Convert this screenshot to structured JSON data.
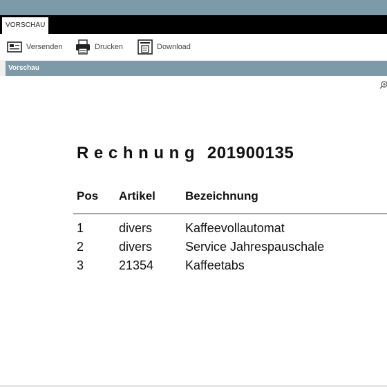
{
  "tab": {
    "label": "VORSCHAU"
  },
  "toolbar": {
    "send_label": "Versenden",
    "print_label": "Drucken",
    "download_label": "Download"
  },
  "section": {
    "title": "Vorschau"
  },
  "invoice": {
    "title_word": "Rechnung",
    "number": "201900135",
    "columns": {
      "pos": "Pos",
      "article": "Artikel",
      "description": "Bezeichnung"
    },
    "rows": [
      {
        "pos": "1",
        "article": "divers",
        "description": "Kaffeevollautomat"
      },
      {
        "pos": "2",
        "article": "divers",
        "description": "Service Jahrespauschale"
      },
      {
        "pos": "3",
        "article": "21354",
        "description": "Kaffeetabs"
      }
    ]
  },
  "icons": {
    "send": "envelope-icon",
    "print": "printer-icon",
    "download": "document-download-icon",
    "zoom": "zoom-in-icon"
  },
  "colors": {
    "header_bar": "#7c9aa8",
    "tab_bar": "#000000"
  }
}
